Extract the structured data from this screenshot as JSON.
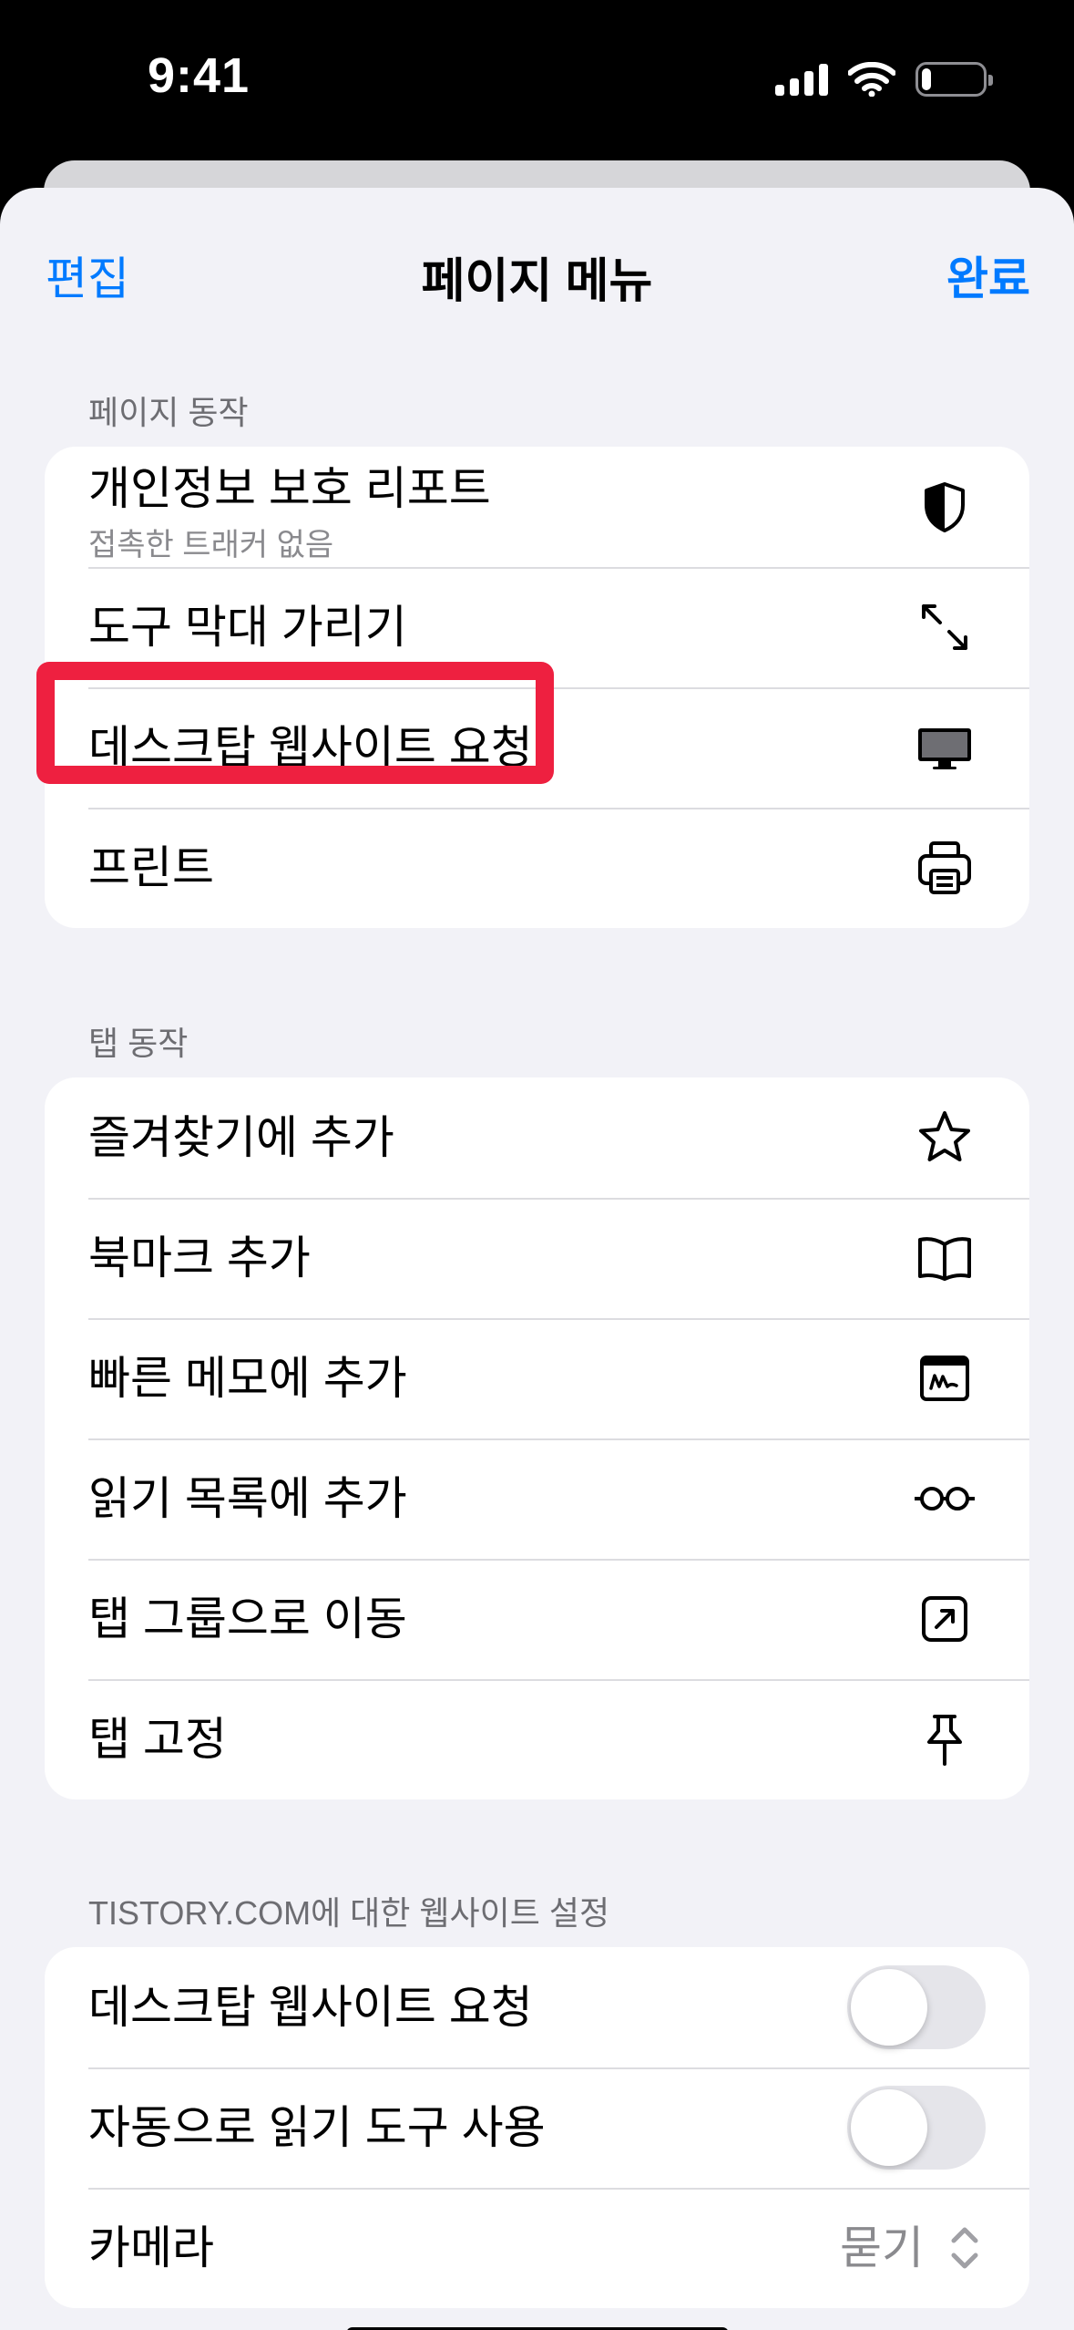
{
  "status_bar": {
    "time": "9:41",
    "battery_level": 0.15
  },
  "nav": {
    "edit_label": "편집",
    "title": "페이지 메뉴",
    "done_label": "완료"
  },
  "page_actions": {
    "header": "페이지 동작",
    "items": [
      {
        "label": "개인정보 보호 리포트",
        "sublabel": "접촉한 트래커 없음",
        "icon": "shield-icon"
      },
      {
        "label": "도구 막대 가리기",
        "icon": "arrows-diagonal-icon"
      },
      {
        "label": "데스크탑 웹사이트 요청",
        "icon": "desktop-icon"
      },
      {
        "label": "프린트",
        "icon": "printer-icon"
      }
    ]
  },
  "tab_actions": {
    "header": "탭 동작",
    "items": [
      {
        "label": "즐겨찾기에 추가",
        "icon": "star-icon"
      },
      {
        "label": "북마크 추가",
        "icon": "book-icon"
      },
      {
        "label": "빠른 메모에 추가",
        "icon": "quick-note-icon"
      },
      {
        "label": "읽기 목록에 추가",
        "icon": "glasses-icon"
      },
      {
        "label": "탭 그룹으로 이동",
        "icon": "move-arrow-icon"
      },
      {
        "label": "탭 고정",
        "icon": "pin-icon"
      }
    ]
  },
  "site_settings": {
    "header": "TISTORY.COM에 대한 웹사이트 설정",
    "items": [
      {
        "label": "데스크탑 웹사이트 요청",
        "type": "toggle",
        "on": false
      },
      {
        "label": "자동으로 읽기 도구 사용",
        "type": "toggle",
        "on": false
      },
      {
        "label": "카메라",
        "type": "select",
        "value": "묻기"
      }
    ]
  },
  "colors": {
    "accent": "#007aff",
    "highlight": "#ee2040",
    "background": "#f2f2f7"
  }
}
